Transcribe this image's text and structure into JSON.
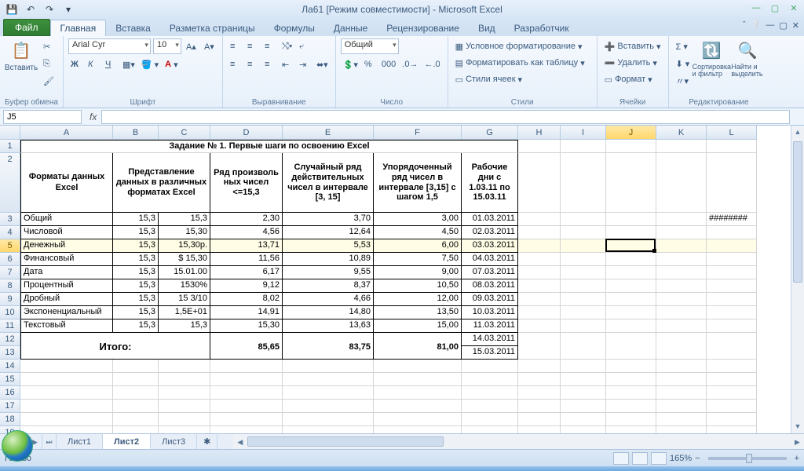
{
  "title": "Ла61  [Режим совместимости]  -  Microsoft Excel",
  "tabs": {
    "file": "Файл",
    "home": "Главная",
    "insert": "Вставка",
    "layout": "Разметка страницы",
    "formulas": "Формулы",
    "data": "Данные",
    "review": "Рецензирование",
    "view": "Вид",
    "dev": "Разработчик"
  },
  "ribbon": {
    "clipboard": {
      "label": "Буфер обмена",
      "paste": "Вставить"
    },
    "font": {
      "label": "Шрифт",
      "name": "Arial Cyr",
      "size": "10",
      "bold": "Ж",
      "italic": "К",
      "underline": "Ч"
    },
    "align": {
      "label": "Выравнивание"
    },
    "number": {
      "label": "Число",
      "format": "Общий"
    },
    "styles": {
      "label": "Стили",
      "cond": "Условное форматирование",
      "table": "Форматировать как таблицу",
      "cell": "Стили ячеек"
    },
    "cells": {
      "label": "Ячейки",
      "insert": "Вставить",
      "delete": "Удалить",
      "format": "Формат"
    },
    "editing": {
      "label": "Редактирование",
      "sort": "Сортировка и фильтр",
      "find": "Найти и выделить"
    }
  },
  "namebox": "J5",
  "columns": [
    "A",
    "B",
    "C",
    "D",
    "E",
    "F",
    "G",
    "H",
    "I",
    "J",
    "K",
    "L"
  ],
  "sheet": {
    "title": "Задание № 1. Первые шаги по освоению Excel",
    "headers": {
      "A": "Форматы данных  Excel",
      "BC": "Представление данных в различных форматах Excel",
      "D": "Ряд произволь ных чисел <=15,3",
      "E": "Случайный ряд действительных чисел в интервале [3, 15]",
      "F": "Упорядоченный ряд чисел в интервале [3,15] с шагом 1,5",
      "G": "Рабочие дни с 1.03.11 по 15.03.11"
    },
    "rows": [
      {
        "n": 3,
        "a": "Общий",
        "b": "15,3",
        "c": "15,3",
        "d": "2,30",
        "e": "3,70",
        "f": "3,00",
        "g": "01.03.2011"
      },
      {
        "n": 4,
        "a": "Числовой",
        "b": "15,3",
        "c": "15,30",
        "d": "4,56",
        "e": "12,64",
        "f": "4,50",
        "g": "02.03.2011"
      },
      {
        "n": 5,
        "a": "Денежный",
        "b": "15,3",
        "c": "15,30р.",
        "d": "13,71",
        "e": "5,53",
        "f": "6,00",
        "g": "03.03.2011",
        "sel": true
      },
      {
        "n": 6,
        "a": "Финансовый",
        "b": "15,3",
        "c": "$    15,30",
        "d": "11,56",
        "e": "10,89",
        "f": "7,50",
        "g": "04.03.2011"
      },
      {
        "n": 7,
        "a": "Дата",
        "b": "15,3",
        "c": "15.01.00",
        "d": "6,17",
        "e": "9,55",
        "f": "9,00",
        "g": "07.03.2011"
      },
      {
        "n": 8,
        "a": "Процентный",
        "b": "15,3",
        "c": "1530%",
        "d": "9,12",
        "e": "8,37",
        "f": "10,50",
        "g": "08.03.2011"
      },
      {
        "n": 9,
        "a": "Дробный",
        "b": "15,3",
        "c": "15   3/10",
        "d": "8,02",
        "e": "4,66",
        "f": "12,00",
        "g": "09.03.2011"
      },
      {
        "n": 10,
        "a": "Экспоненциальный",
        "b": "15,3",
        "c": "1,5E+01",
        "d": "14,91",
        "e": "14,80",
        "f": "13,50",
        "g": "10.03.2011"
      },
      {
        "n": 11,
        "a": "Текстовый",
        "b": "15,3",
        "c": "15,3",
        "d": "15,30",
        "e": "13,63",
        "f": "15,00",
        "g": "11.03.2011"
      }
    ],
    "totals": {
      "label": "Итого:",
      "d": "85,65",
      "e": "83,75",
      "f": "81,00",
      "g12": "14.03.2011",
      "g13": "15.03.2011"
    },
    "overflow_L": "########"
  },
  "sheet_tabs": {
    "s1": "Лист1",
    "s2": "Лист2",
    "s3": "Лист3"
  },
  "status": {
    "ready": "Готово",
    "zoom": "165%"
  }
}
